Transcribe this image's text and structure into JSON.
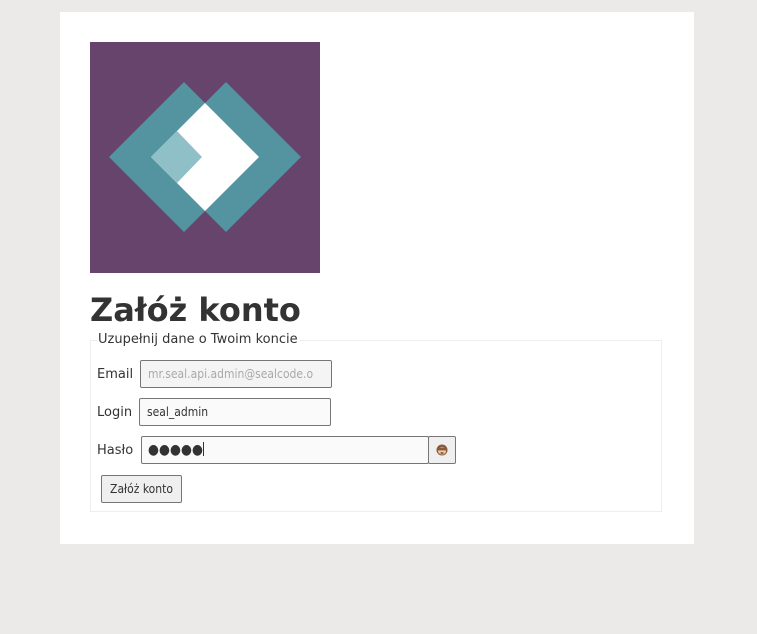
{
  "logo": {
    "icon": "app-logo-icon",
    "colors": {
      "background": "#66446c",
      "teal": "#5394a0",
      "light_teal": "#8fbfc7",
      "white": "#ffffff"
    }
  },
  "page": {
    "title": "Załóż konto"
  },
  "form": {
    "legend": "Uzupełnij dane o Twoim koncie",
    "email": {
      "label": "Email",
      "value": "",
      "placeholder": "mr.seal.api.admin@sealcode.o"
    },
    "login": {
      "label": "Login",
      "value": "seal_admin"
    },
    "password": {
      "label": "Hasło",
      "masked_value": "●●●●●",
      "toggle_icon": "monkey-face-icon"
    },
    "submit_label": "Załóż konto"
  }
}
